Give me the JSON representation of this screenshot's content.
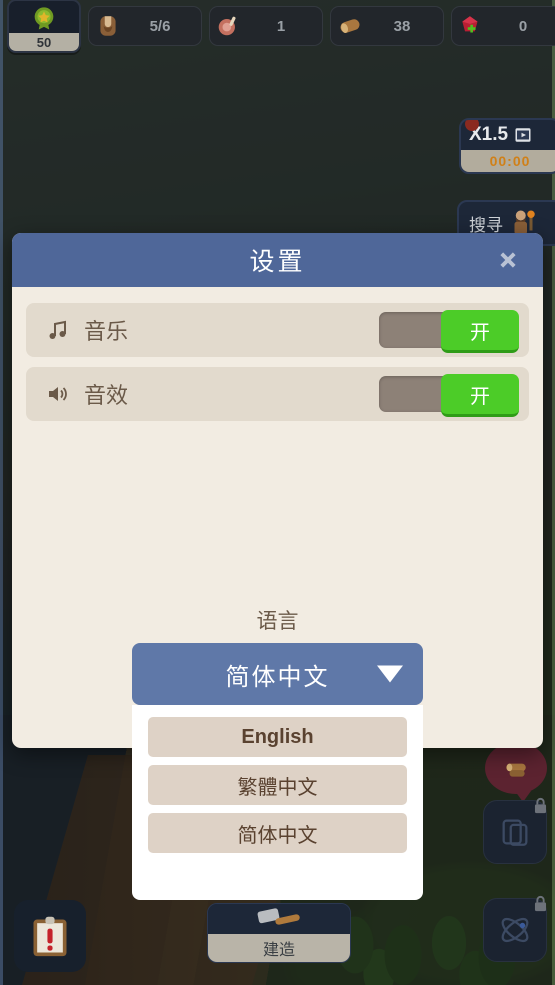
{
  "hud": {
    "level_badge": {
      "name": "level-badge",
      "value": "50",
      "icon": "star-medal-icon"
    },
    "resources": [
      {
        "name": "population",
        "icon": "villager-icon",
        "value": "5/6"
      },
      {
        "name": "food",
        "icon": "meat-icon",
        "value": "1"
      },
      {
        "name": "wood",
        "icon": "log-icon",
        "value": "38"
      },
      {
        "name": "gems",
        "icon": "gem-plus-icon",
        "value": "0"
      }
    ],
    "boost": {
      "multiplier": "X1.5",
      "icon": "video-ad-icon",
      "timer": "00:00"
    },
    "search_button": {
      "label": "搜寻",
      "icon": "explorer-icon"
    },
    "quest_button": {
      "icon": "clipboard-alert-icon"
    },
    "build_button": {
      "label": "建造",
      "icon": "hammer-icon"
    },
    "cards_button": {
      "icon": "card-collection-icon",
      "locked_icon": "lock-icon"
    },
    "research_button": {
      "icon": "atom-icon",
      "locked_icon": "lock-icon"
    },
    "bubble": {
      "icon": "log-icon"
    }
  },
  "dialog": {
    "title": "设置",
    "close_icon": "close-icon",
    "rows": [
      {
        "name": "music",
        "icon": "music-note-icon",
        "label": "音乐",
        "state": "开"
      },
      {
        "name": "sound",
        "icon": "speaker-icon",
        "label": "音效",
        "state": "开"
      }
    ],
    "language": {
      "label": "语言",
      "selected": "简体中文",
      "caret_icon": "chevron-down-icon",
      "options": [
        "English",
        "繁體中文",
        "简体中文"
      ]
    }
  },
  "colors": {
    "header_blue": "#4f6799",
    "dialog_cream": "#f2ece2",
    "row_beige": "#e2dacd",
    "toggle_on_green": "#4ccc28",
    "toggle_track": "#8d8177",
    "select_blue": "#5f78a8",
    "option_beige": "#ded2c6",
    "text_brown": "#6b5a49"
  }
}
